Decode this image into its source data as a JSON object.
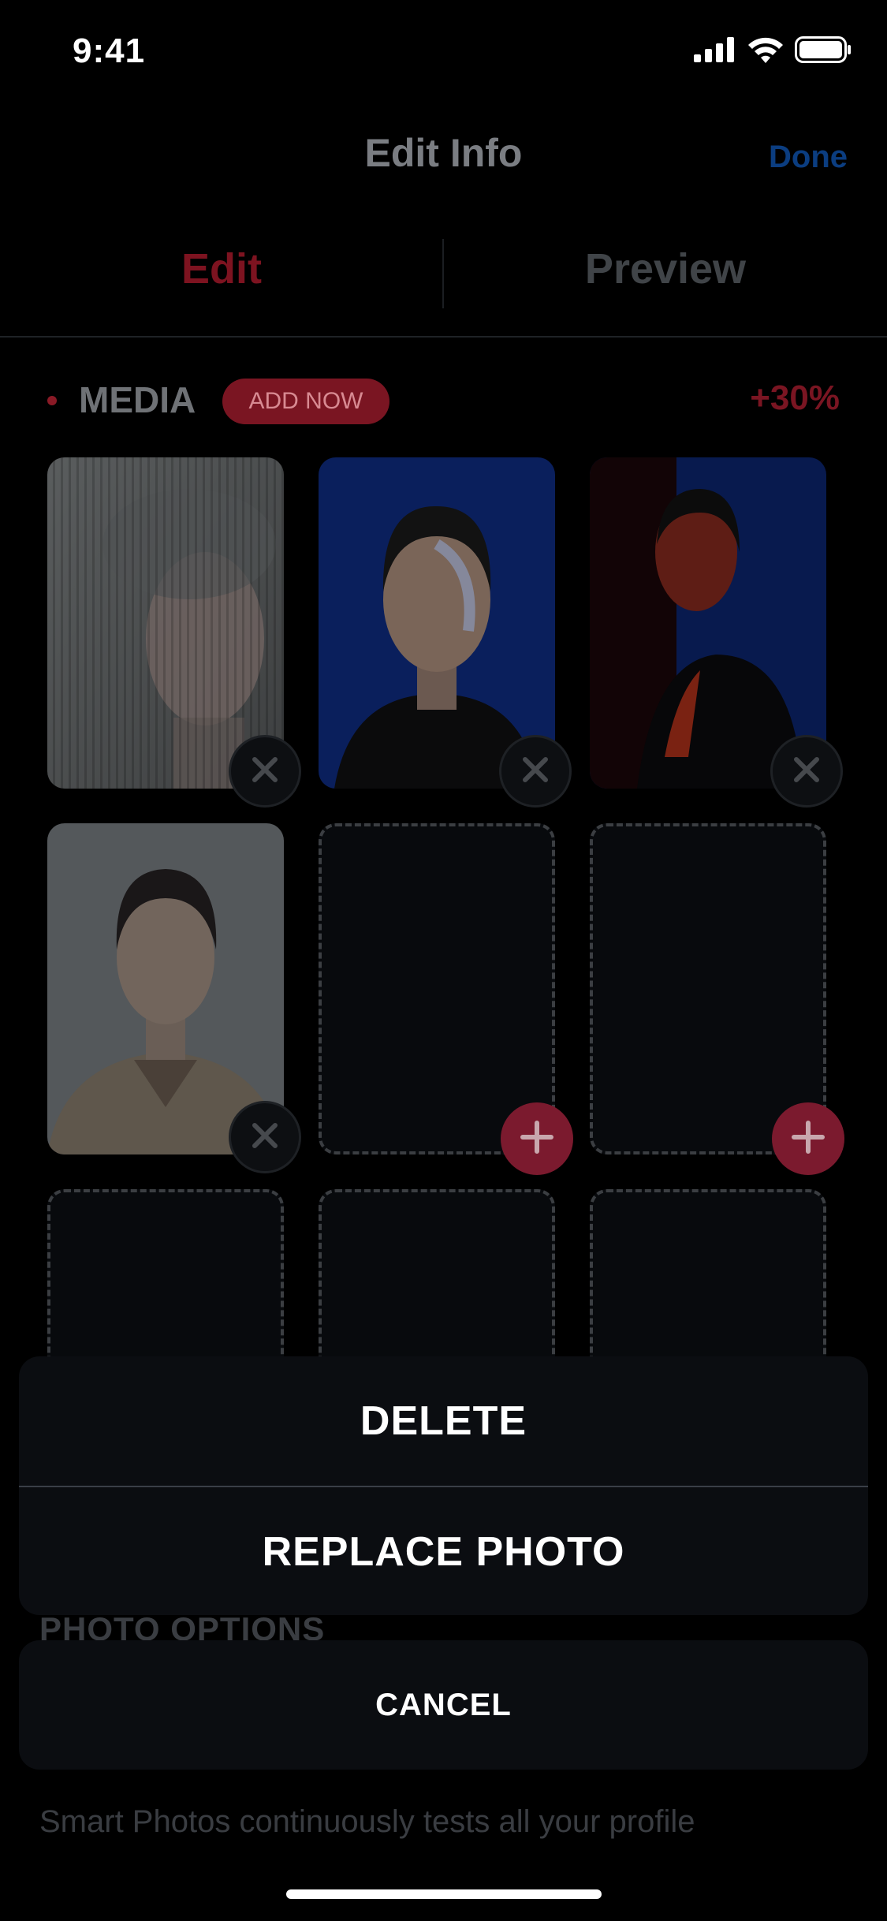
{
  "status_bar": {
    "time": "9:41"
  },
  "header": {
    "title": "Edit Info",
    "done_label": "Done"
  },
  "tabs": [
    {
      "label": "Edit"
    },
    {
      "label": "Preview"
    }
  ],
  "media": {
    "label": "MEDIA",
    "add_now_label": "ADD NOW",
    "boost_percent": "+30%"
  },
  "grid": {
    "photos": [
      {
        "description": "woman behind ribbed glass",
        "remove_icon": "close-icon"
      },
      {
        "description": "woman on blue background",
        "remove_icon": "close-icon"
      },
      {
        "description": "woman in red light on blue",
        "remove_icon": "close-icon"
      },
      {
        "description": "woman in beige jacket",
        "remove_icon": "close-icon"
      }
    ],
    "empty_slot_icon": "plus-icon"
  },
  "action_sheet": {
    "delete_label": "DELETE",
    "replace_label": "REPLACE PHOTO",
    "cancel_label": "CANCEL"
  },
  "photo_options": {
    "title": "PHOTO OPTIONS",
    "description": "Smart Photos continuously tests all your profile"
  },
  "colors": {
    "accent_red": "#7a1522",
    "done_blue": "#0b3d80",
    "background": "#000000"
  }
}
